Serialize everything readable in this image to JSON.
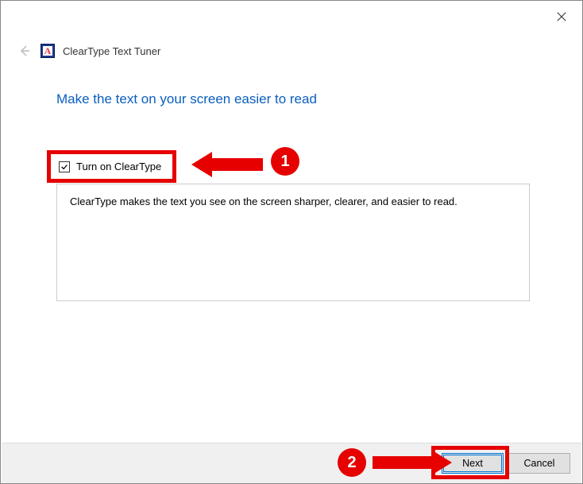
{
  "window": {
    "title": "ClearType Text Tuner"
  },
  "heading": "Make the text on your screen easier to read",
  "checkbox": {
    "label": "Turn on ClearType",
    "checked": true
  },
  "description": "ClearType makes the text you see on the screen sharper, clearer, and easier to read.",
  "buttons": {
    "next": "Next",
    "cancel": "Cancel"
  },
  "annotations": {
    "badge1": "1",
    "badge2": "2"
  }
}
